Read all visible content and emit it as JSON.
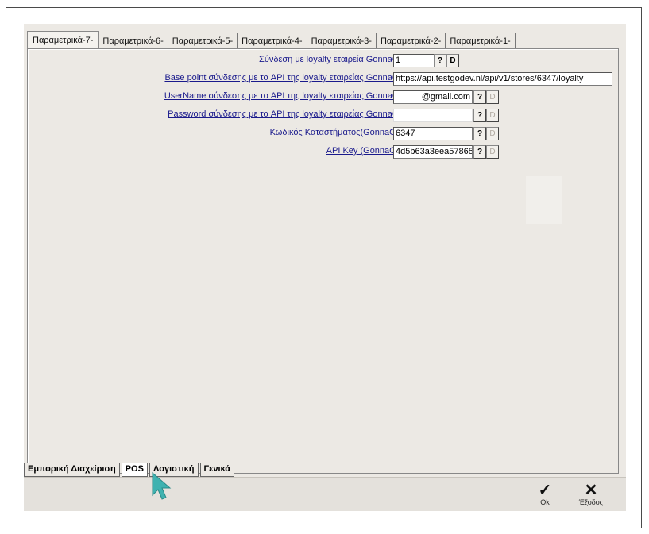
{
  "top_tabs": [
    "Παραμετρικά-7-",
    "Παραμετρικά-6-",
    "Παραμετρικά-5-",
    "Παραμετρικά-4-",
    "Παραμετρικά-3-",
    "Παραμετρικά-2-",
    "Παραμετρικά-1-"
  ],
  "fields": [
    {
      "label": "Σύνδεση με loyalty εταιρεία GonnaOrder:",
      "value": "1",
      "help": "?",
      "d": "D"
    },
    {
      "label": "Base point σύνδεσης με το API της loyalty εταιρείας GonnaOrder:",
      "value": "https://api.testgodev.nl/api/v1/stores/6347/loyalty"
    },
    {
      "label": "UserName σύνδεσης με το API της loyalty εταιρείας GonnaOrder:",
      "value": "@gmail.com",
      "help": "?",
      "d": "D"
    },
    {
      "label": "Password σύνδεσης με το API της loyalty εταιρείας GonnaOrder:",
      "value": "",
      "help": "?",
      "d": "D"
    },
    {
      "label": "Κωδικός Καταστήματος(GonnaOrder):",
      "value": "6347",
      "help": "?",
      "d": "D"
    },
    {
      "label": "API Key (GonnaOrder):",
      "value": "4d5b63a3eea57865",
      "help": "?",
      "d": "D"
    }
  ],
  "bottom_tabs": [
    "Εμπορική Διαχείριση",
    "POS",
    "Λογιστική",
    "Γενικά"
  ],
  "toolbar": {
    "ok_label": "Ok",
    "exit_label": "Έξοδος",
    "ok_icon": "check-icon",
    "exit_icon": "close-icon"
  }
}
